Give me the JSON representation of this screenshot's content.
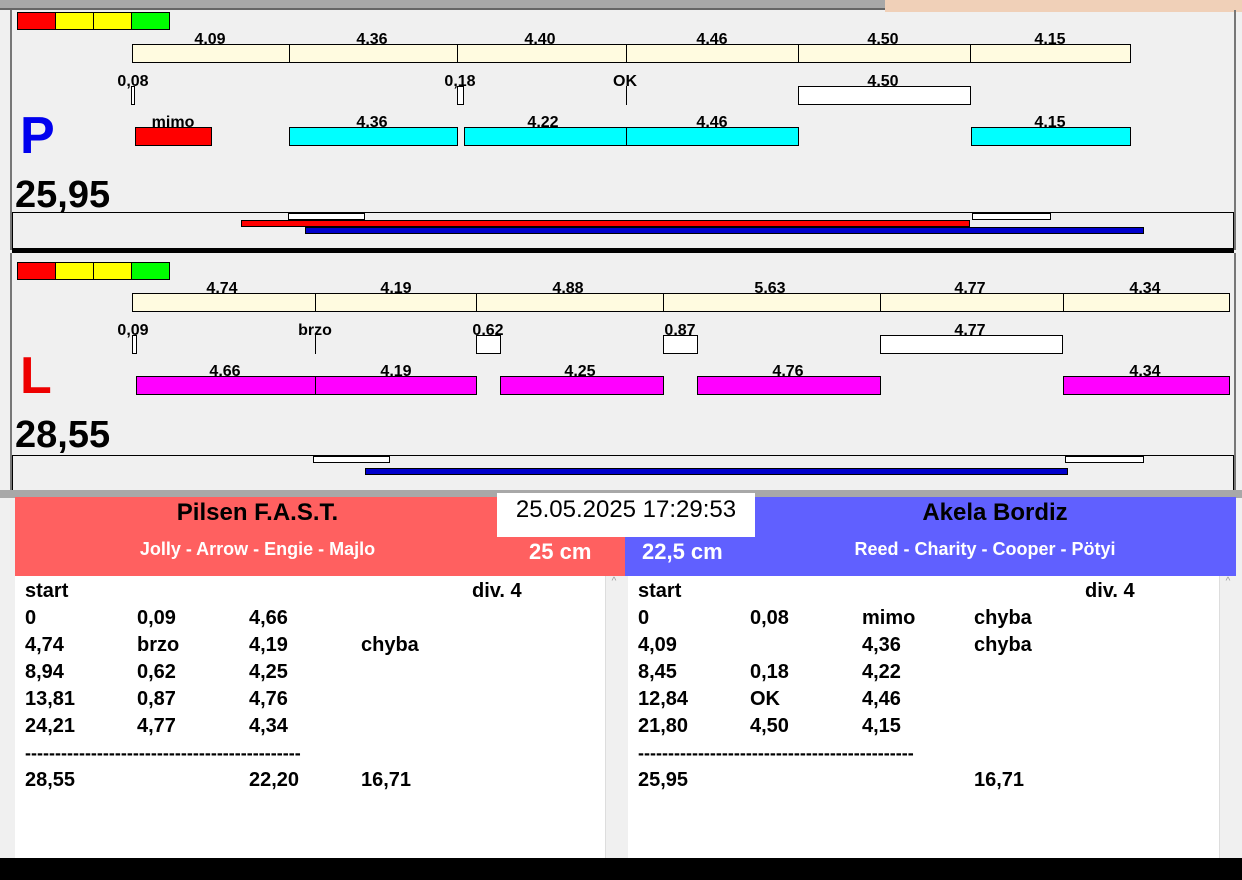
{
  "colors": {
    "red": "#ff0000",
    "yellow": "#ffff00",
    "green": "#00ff00",
    "cyan": "#00ffff",
    "magenta": "#ff00ff",
    "blue": "#0000cc",
    "team_left": "#ff6060",
    "team_right": "#6060ff"
  },
  "p": {
    "letter": "P",
    "total": "25,95",
    "row1": [
      "4,09",
      "4,36",
      "4,40",
      "4,46",
      "4,50",
      "4,15"
    ],
    "row2": [
      "0,08",
      "0,18",
      "OK",
      "4,50"
    ],
    "row3": [
      "mimo",
      "4,36",
      "4,22",
      "4,46",
      "4,15"
    ]
  },
  "l": {
    "letter": "L",
    "total": "28,55",
    "row1": [
      "4,74",
      "4,19",
      "4,88",
      "5,63",
      "4,77",
      "4,34"
    ],
    "row2": [
      "0,09",
      "brzo",
      "0,62",
      "0,87",
      "4,77"
    ],
    "row3": [
      "4,66",
      "4,19",
      "4,25",
      "4,76",
      "4,34"
    ]
  },
  "datetime": "25.05.2025 17:29:53",
  "left_team": {
    "name": "Pilsen F.A.S.T.",
    "dogs": "Jolly - Arrow - Engie - Majlo",
    "height": "25 cm",
    "header": [
      "start",
      "div.  4"
    ],
    "rows": [
      [
        "0",
        "0,09",
        "4,66",
        ""
      ],
      [
        "4,74",
        "brzo",
        "4,19",
        "chyba"
      ],
      [
        "8,94",
        "0,62",
        "4,25",
        ""
      ],
      [
        "13,81",
        "0,87",
        "4,76",
        ""
      ],
      [
        "24,21",
        "4,77",
        "4,34",
        ""
      ]
    ],
    "separator": "----------------------------------------------",
    "totals": [
      "28,55",
      "",
      "22,20",
      "16,71"
    ]
  },
  "right_team": {
    "name": "Akela Bordiz",
    "dogs": "Reed - Charity - Cooper - Pötyi",
    "height": "22,5 cm",
    "header": [
      "start",
      "div.  4"
    ],
    "rows": [
      [
        "0",
        "0,08",
        "mimo",
        "chyba"
      ],
      [
        "4,09",
        "",
        "4,36",
        "chyba"
      ],
      [
        "8,45",
        "0,18",
        "4,22",
        ""
      ],
      [
        "12,84",
        "OK",
        "4,46",
        ""
      ],
      [
        "21,80",
        "4,50",
        "4,15",
        ""
      ]
    ],
    "separator": "----------------------------------------------",
    "totals": [
      "25,95",
      "",
      "",
      "16,71"
    ]
  }
}
